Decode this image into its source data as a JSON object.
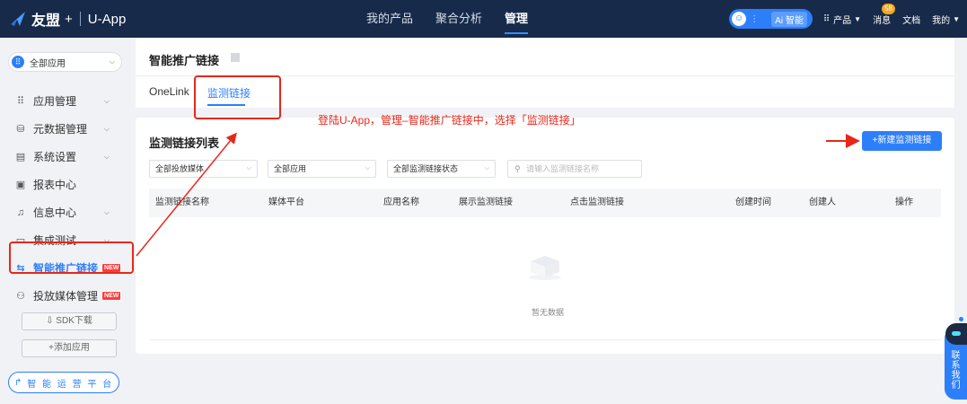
{
  "topbar": {
    "brand": "友盟",
    "plus": "+",
    "product": "U-App",
    "nav": [
      {
        "label": "我的产品"
      },
      {
        "label": "聚合分析"
      },
      {
        "label": "管理"
      }
    ],
    "ai_dots": "⋮",
    "ai_label": "Ai 智能",
    "products": "产品",
    "messages": "消息",
    "messages_badge": "58",
    "docs": "文档",
    "mine": "我的"
  },
  "sidebar": {
    "app_select": "全部应用",
    "items": [
      {
        "label": "应用管理",
        "icon": "grid-list-icon",
        "glyph": "⠿"
      },
      {
        "label": "元数据管理",
        "icon": "database-icon",
        "glyph": "⛁"
      },
      {
        "label": "系统设置",
        "icon": "settings-panel-icon",
        "glyph": "▤"
      },
      {
        "label": "报表中心",
        "icon": "report-icon",
        "glyph": "▣"
      },
      {
        "label": "信息中心",
        "icon": "bell-icon",
        "glyph": "♫"
      },
      {
        "label": "集成测试",
        "icon": "test-monitor-icon",
        "glyph": "▭"
      },
      {
        "label": "智能推广链接",
        "icon": "link-transfer-icon",
        "glyph": "⇆",
        "tag": "NEW"
      },
      {
        "label": "投放媒体管理",
        "icon": "media-icon",
        "glyph": "⚇",
        "tag": "NEW"
      }
    ],
    "sdk_download": "⇩ SDK下载",
    "add_app": "+添加应用",
    "ops_platform": "智 能 运 营 平 台"
  },
  "header": {
    "title": "智能推广链接",
    "tabs": [
      {
        "label": "OneLink"
      },
      {
        "label": "监测链接"
      }
    ]
  },
  "main": {
    "list_title": "监测链接列表",
    "new_button": "+新建监测链接",
    "filters": [
      {
        "value": "全部投放媒体"
      },
      {
        "value": "全部应用"
      },
      {
        "value": "全部监测链接状态"
      }
    ],
    "search_placeholder": "请输入监测链接名称",
    "columns": [
      "监测链接名称",
      "媒体平台",
      "应用名称",
      "展示监测链接",
      "点击监测链接",
      "创建时间",
      "创建人",
      "操作"
    ],
    "empty_text": "暂无数据"
  },
  "annotation": {
    "note": "登陆U-App，管理–智能推广链接中，选择「监测链接」"
  },
  "float": {
    "contact": "联系我们"
  },
  "colors": {
    "topbar": "#172a4a",
    "accent": "#2d7ff9",
    "annotation": "#e8271a",
    "new_tag": "#ff3b3b"
  }
}
